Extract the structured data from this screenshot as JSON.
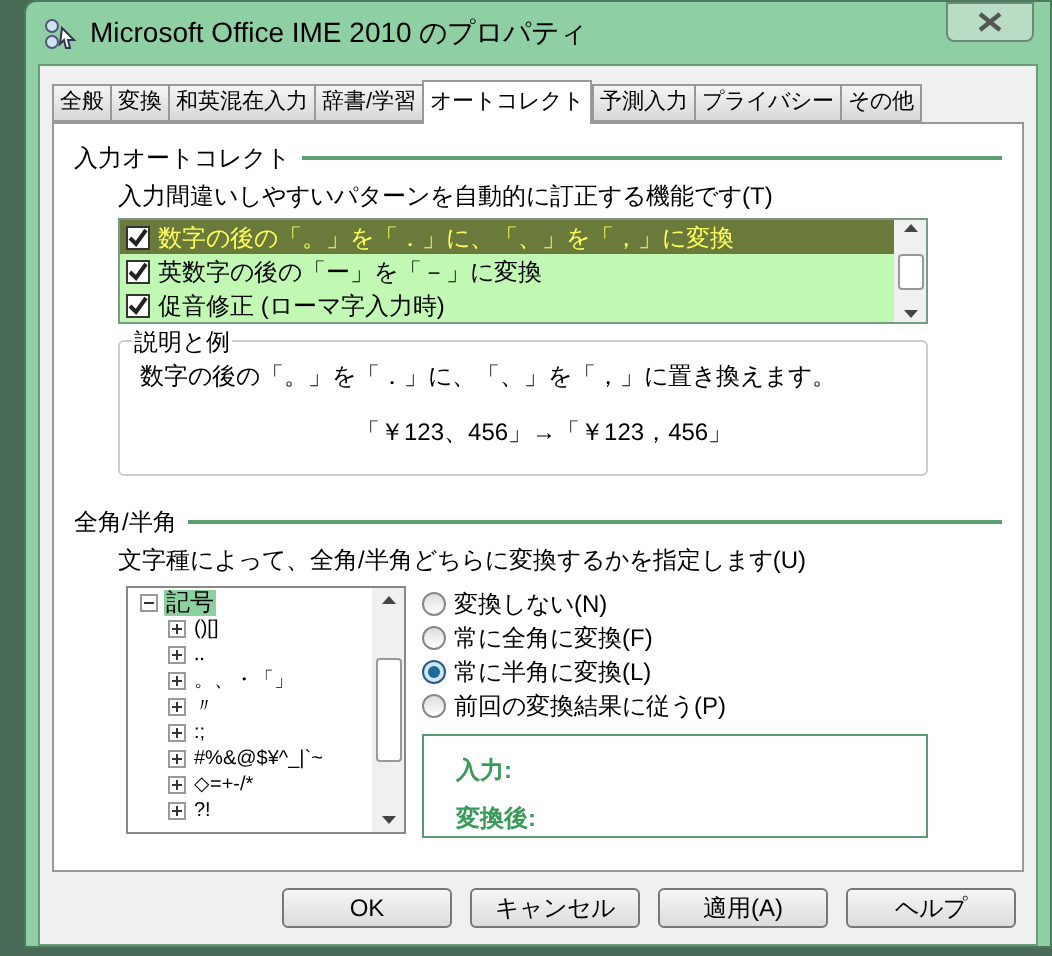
{
  "window": {
    "title": "Microsoft Office IME 2010 のプロパティ"
  },
  "tabs": [
    {
      "label": "全般",
      "selected": false
    },
    {
      "label": "変換",
      "selected": false
    },
    {
      "label": "和英混在入力",
      "selected": false
    },
    {
      "label": "辞書/学習",
      "selected": false
    },
    {
      "label": "オートコレクト",
      "selected": true
    },
    {
      "label": "予測入力",
      "selected": false
    },
    {
      "label": "プライバシー",
      "selected": false
    },
    {
      "label": "その他",
      "selected": false
    }
  ],
  "autocorrect": {
    "heading": "入力オートコレクト",
    "description": "入力間違いしやすいパターンを自動的に訂正する機能です(T)",
    "items": [
      {
        "label": "数字の後の「。」を「．」に、「、」を「，」に変換",
        "checked": true,
        "selected": true
      },
      {
        "label": "英数字の後の「ー」を「－」に変換",
        "checked": true,
        "selected": false
      },
      {
        "label": "促音修正 (ローマ字入力時)",
        "checked": true,
        "selected": false
      }
    ],
    "explanation": {
      "heading": "説明と例",
      "text": "数字の後の「。」を「．」に、「、」を「，」に置き換えます。",
      "example": "「￥123、456」→「￥123，456」"
    }
  },
  "width": {
    "heading": "全角/半角",
    "description": "文字種によって、全角/半角どちらに変換するかを指定します(U)",
    "tree": [
      {
        "label": "記号",
        "expanded": true,
        "selected": true,
        "children": [
          {
            "label": "()[]",
            "expanded": false,
            "selected": false
          },
          {
            "label": "‥",
            "expanded": false,
            "selected": false
          },
          {
            "label": "。、・「」",
            "expanded": false,
            "selected": false
          },
          {
            "label": "〃",
            "expanded": false,
            "selected": false
          },
          {
            "label": ":;",
            "expanded": false,
            "selected": false
          },
          {
            "label": "#%&@$¥^_|`~",
            "expanded": false,
            "selected": false
          },
          {
            "label": "◇=+-/*",
            "expanded": false,
            "selected": false
          },
          {
            "label": "?!",
            "expanded": false,
            "selected": false
          }
        ]
      }
    ],
    "options": [
      {
        "label": "変換しない(N)",
        "selected": false
      },
      {
        "label": "常に全角に変換(F)",
        "selected": false
      },
      {
        "label": "常に半角に変換(L)",
        "selected": true
      },
      {
        "label": "前回の変換結果に従う(P)",
        "selected": false
      }
    ],
    "preview": {
      "input_label": "入力:",
      "output_label": "変換後:"
    }
  },
  "buttons": [
    "OK",
    "キャンセル",
    "適用(A)",
    "ヘルプ"
  ]
}
